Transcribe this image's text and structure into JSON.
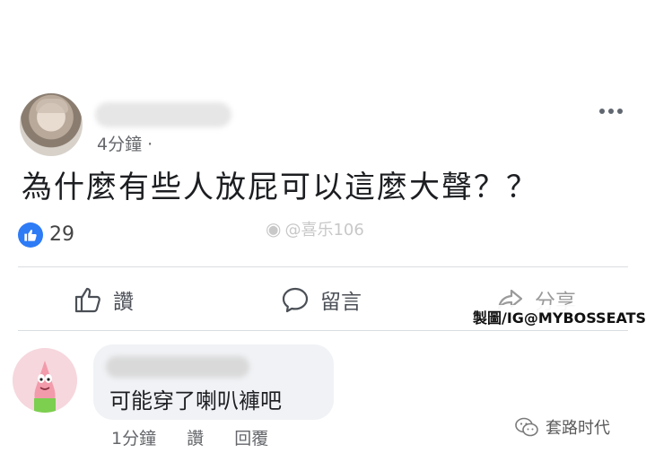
{
  "post": {
    "time": "4分鐘 ·",
    "text": "為什麼有些人放屁可以這麼大聲？？",
    "like_count": "29"
  },
  "actions": {
    "like_label": "讚",
    "comment_label": "留言",
    "share_label": "分享"
  },
  "overlay": {
    "watermark": "@喜乐106",
    "credit": "製圖/IG@MYBOSSEATSHIT",
    "brand": "套路时代"
  },
  "comment": {
    "text": "可能穿了喇叭褲吧",
    "time": "1分鐘",
    "like_label": "讚",
    "reply_label": "回覆"
  },
  "colors": {
    "accent": "#2e7bf6",
    "meta_text": "#65676b",
    "bubble": "#f0f2f5",
    "divider": "#dadde1"
  },
  "icons": [
    "more-icon",
    "thumbs-up-icon",
    "comment-icon",
    "share-icon",
    "wechat-icon"
  ]
}
